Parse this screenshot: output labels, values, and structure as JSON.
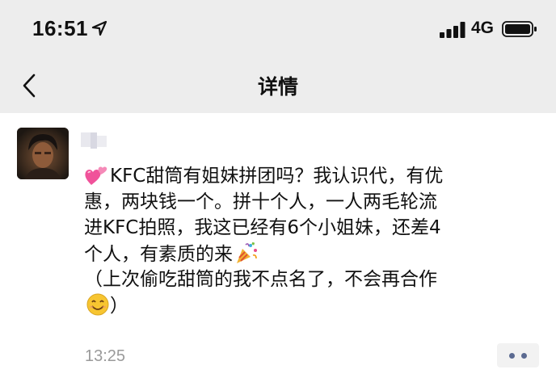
{
  "status_bar": {
    "time": "16:51",
    "network": "4G",
    "icons": [
      "location-arrow-icon",
      "signal-icon",
      "battery-icon"
    ]
  },
  "nav": {
    "back_icon": "back-chevron-icon",
    "title": "详情"
  },
  "post": {
    "avatar": "avatar",
    "lines": [
      "KFC甜筒有姐妹拼团吗？我认识代，有优",
      "惠，两块钱一个。拼十个人，一人两毛轮流",
      "进KFC拍照，我这已经有6个小姐妹，还差4",
      "个人，有素质的来",
      "（上次偷吃甜筒的我不点名了，不会再合作",
      "）"
    ],
    "emojis": [
      "two-hearts-emoji",
      "party-popper-emoji",
      "smile-emoji"
    ],
    "timestamp": "13:25",
    "more_icon": "more-dots-icon"
  },
  "colors": {
    "bar_background": "#ededed",
    "timestamp": "#9a9a9a",
    "more_dots": "#5b6a91"
  }
}
